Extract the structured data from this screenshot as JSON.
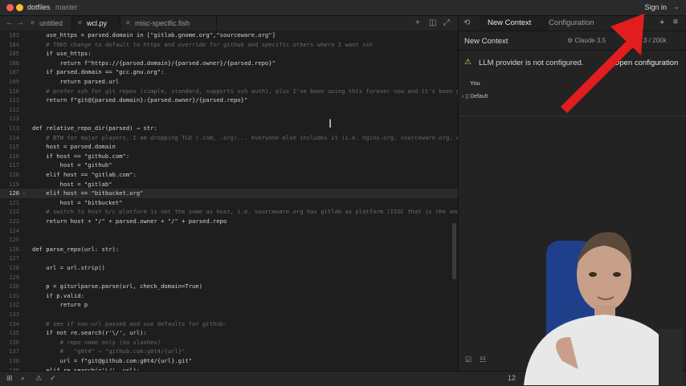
{
  "titlebar": {
    "project": "dotfiles",
    "branch": "master",
    "sign_in": "Sign in",
    "chevron": "⌄"
  },
  "tabs": [
    {
      "label": "untitled",
      "active": false
    },
    {
      "label": "wcl.py",
      "active": true
    },
    {
      "label": "misc-specific.fish",
      "active": false
    }
  ],
  "editor": {
    "current_line": 120,
    "lines": [
      {
        "n": "183",
        "text": "    use_https = parsed.domain in [\"gitlab.gnome.org\",\"sourceware.org\"]",
        "type": "code"
      },
      {
        "n": "184",
        "text": "    # TODO change to default to https and override for github and specific others where I want ssh",
        "type": "comment"
      },
      {
        "n": "185",
        "text": "    if use_https:",
        "type": "code"
      },
      {
        "n": "186",
        "text": "        return f\"https://{parsed.domain}/{parsed.owner}/{parsed.repo}\"",
        "type": "code"
      },
      {
        "n": "187",
        "text": "    if parsed.domain == \"gcc.gnu.org\":",
        "type": "code"
      },
      {
        "n": "109",
        "text": "        return parsed.url",
        "type": "code"
      },
      {
        "n": "110",
        "text": "    # prefer ssh for git repos (simple, standard, supports ssh auth), plus I've been using this forever now and it's been gr",
        "type": "comment"
      },
      {
        "n": "111",
        "text": "    return f\"git@{parsed.domain}:{parsed.owner}/{parsed.repo}\"",
        "type": "code"
      },
      {
        "n": "112",
        "text": "",
        "type": "code"
      },
      {
        "n": "113",
        "text": "",
        "type": "code"
      },
      {
        "n": "113",
        "text": "def relative_repo_dir(parsed) → str:",
        "type": "code"
      },
      {
        "n": "114",
        "text": "    # BTW for major players, I am dropping TLD (.com, .org)... everyone else includes it (i.e. nginx.org, sourceware.org, et",
        "type": "comment"
      },
      {
        "n": "115",
        "text": "    host = parsed.domain",
        "type": "code"
      },
      {
        "n": "116",
        "text": "    if host == \"github.com\":",
        "type": "code"
      },
      {
        "n": "117",
        "text": "        host = \"github\"",
        "type": "code"
      },
      {
        "n": "118",
        "text": "    elif host == \"gitlab.com\":",
        "type": "code"
      },
      {
        "n": "119",
        "text": "        host = \"gitlab\"",
        "type": "code"
      },
      {
        "n": "120",
        "text": "    elif host == \"bitbucket.org\"",
        "type": "code"
      },
      {
        "n": "121",
        "text": "        host = \"bitbucket\"",
        "type": "code"
      },
      {
        "n": "122",
        "text": "    # switch to host b/c platform is not the same as host, i.e. sourceware.org has gitlab as platform (IIGC that is the unde",
        "type": "comment"
      },
      {
        "n": "123",
        "text": "    return host + \"/\" + parsed.owner + \"/\" + parsed.repo",
        "type": "code"
      },
      {
        "n": "124",
        "text": "",
        "type": "code"
      },
      {
        "n": "125",
        "text": "",
        "type": "code"
      },
      {
        "n": "126",
        "text": "def parse_repo(url: str):",
        "type": "code"
      },
      {
        "n": "127",
        "text": "",
        "type": "code"
      },
      {
        "n": "128",
        "text": "    url = url.strip()",
        "type": "code"
      },
      {
        "n": "129",
        "text": "",
        "type": "code"
      },
      {
        "n": "130",
        "text": "    p = giturlparse.parse(url, check_domain=True)",
        "type": "code"
      },
      {
        "n": "131",
        "text": "    if p.valid:",
        "type": "code"
      },
      {
        "n": "132",
        "text": "        return p",
        "type": "code"
      },
      {
        "n": "133",
        "text": "",
        "type": "code"
      },
      {
        "n": "134",
        "text": "    # see if non-url passed and use defaults for github:",
        "type": "comment"
      },
      {
        "n": "135",
        "text": "    if not re.search(r'\\/', url):",
        "type": "code"
      },
      {
        "n": "136",
        "text": "        # repo name only (no slashes)",
        "type": "comment"
      },
      {
        "n": "137",
        "text": "        #   \"g0t4\" ⇒ \"github.com:g0t4/{url}\"",
        "type": "comment"
      },
      {
        "n": "138",
        "text": "        url = f\"git@github.com:g0t4/{url}.git\"",
        "type": "code"
      },
      {
        "n": "139",
        "text": "    elif re.search(r'\\/', url):",
        "type": "code"
      }
    ]
  },
  "panel": {
    "tabs": [
      "New Context",
      "Configuration"
    ],
    "context_title": "New Context",
    "model": "Claude 3.5",
    "tokens": "3 / 200k",
    "warning": "LLM provider is not configured.",
    "open_config": "Open configuration",
    "you_label": "You",
    "default_label": "Default"
  },
  "statusbar": {
    "position": "12"
  },
  "colors": {
    "arrow": "#e11d1d",
    "warning": "#e5c07b"
  }
}
